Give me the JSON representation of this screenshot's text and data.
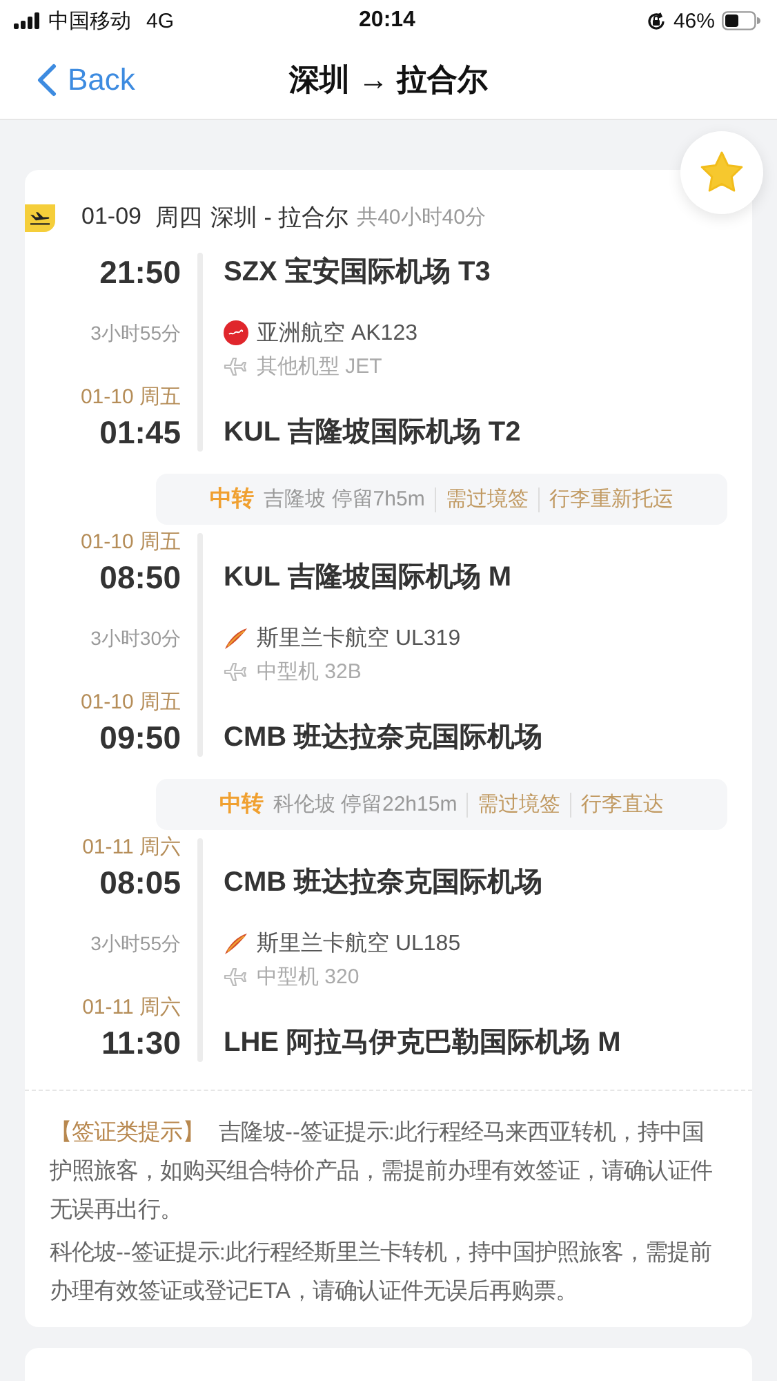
{
  "status_bar": {
    "carrier": "中国移动",
    "network": "4G",
    "time": "20:14",
    "battery": "46%"
  },
  "nav": {
    "back": "Back",
    "title": "深圳 → 拉合尔"
  },
  "favorite": {
    "on": true
  },
  "trip": {
    "date": "01-09",
    "weekday": "周四",
    "route": "深圳 - 拉合尔",
    "total": "共40小时40分"
  },
  "itinerary": [
    {
      "kind": "leg",
      "departure": {
        "time": "21:50",
        "airport": "SZX 宝安国际机场 T3"
      },
      "duration": "3小时55分",
      "airline": {
        "name": "亚洲航空 AK123",
        "kind": "disc"
      },
      "aircraft": "其他机型 JET",
      "arrival": {
        "date": "01-10 周五",
        "time": "01:45",
        "airport": "KUL 吉隆坡国际机场 T2"
      }
    },
    {
      "kind": "transfer",
      "label": "中转",
      "stop": "吉隆坡 停留7h5m",
      "notes": [
        "需过境签",
        "行李重新托运"
      ]
    },
    {
      "kind": "leg",
      "departure": {
        "date": "01-10 周五",
        "time": "08:50",
        "airport": "KUL 吉隆坡国际机场 M"
      },
      "duration": "3小时30分",
      "airline": {
        "name": "斯里兰卡航空 UL319",
        "kind": "feather"
      },
      "aircraft": "中型机 32B",
      "arrival": {
        "date": "01-10 周五",
        "time": "09:50",
        "airport": "CMB 班达拉奈克国际机场"
      }
    },
    {
      "kind": "transfer",
      "label": "中转",
      "stop": "科伦坡 停留22h15m",
      "notes": [
        "需过境签",
        "行李直达"
      ]
    },
    {
      "kind": "leg",
      "departure": {
        "date": "01-11 周六",
        "time": "08:05",
        "airport": "CMB 班达拉奈克国际机场"
      },
      "duration": "3小时55分",
      "airline": {
        "name": "斯里兰卡航空 UL185",
        "kind": "feather"
      },
      "aircraft": "中型机 320",
      "arrival": {
        "date": "01-11 周六",
        "time": "11:30",
        "airport": "LHE 阿拉马伊克巴勒国际机场 M"
      }
    }
  ],
  "notice": {
    "paragraphs": [
      "**【签证类提示】** 吉隆坡--签证提示:此行程经马来西亚转机，持中国护照旅客，如购买组合特价产品，需提前办理有效签证，请确认证件无误再出行。",
      "科伦坡--签证提示:此行程经斯里兰卡转机，持中国护照旅客，需提前办理有效签证或登记ETA，请确认证件无误后再购票。"
    ]
  }
}
